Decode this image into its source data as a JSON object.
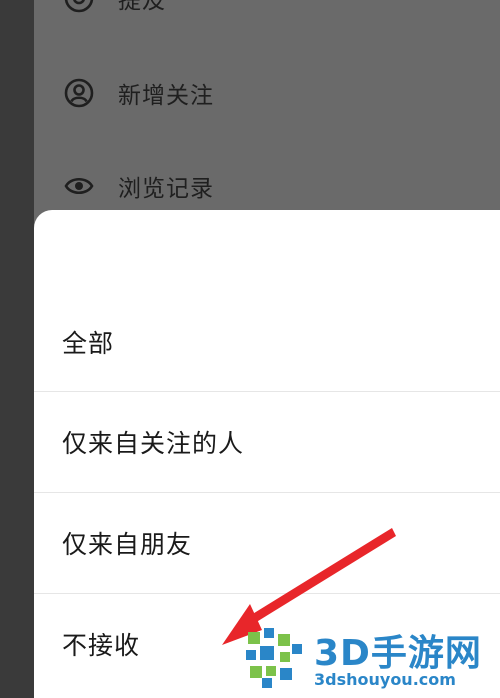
{
  "background_menu": {
    "items": [
      {
        "label": "提及",
        "icon": "at-icon"
      },
      {
        "label": "新增关注",
        "icon": "user-circle-icon"
      },
      {
        "label": "浏览记录",
        "icon": "eye-icon"
      }
    ]
  },
  "sheet": {
    "options": [
      "全部",
      "仅来自关注的人",
      "仅来自朋友",
      "不接收"
    ]
  },
  "watermark": {
    "title": "3D手游网",
    "url": "3dshouyou.com"
  },
  "colors": {
    "overlay": "#6a6a6a",
    "sheet": "#ffffff",
    "arrow": "#e8262a",
    "watermark": "#2a86c8"
  }
}
